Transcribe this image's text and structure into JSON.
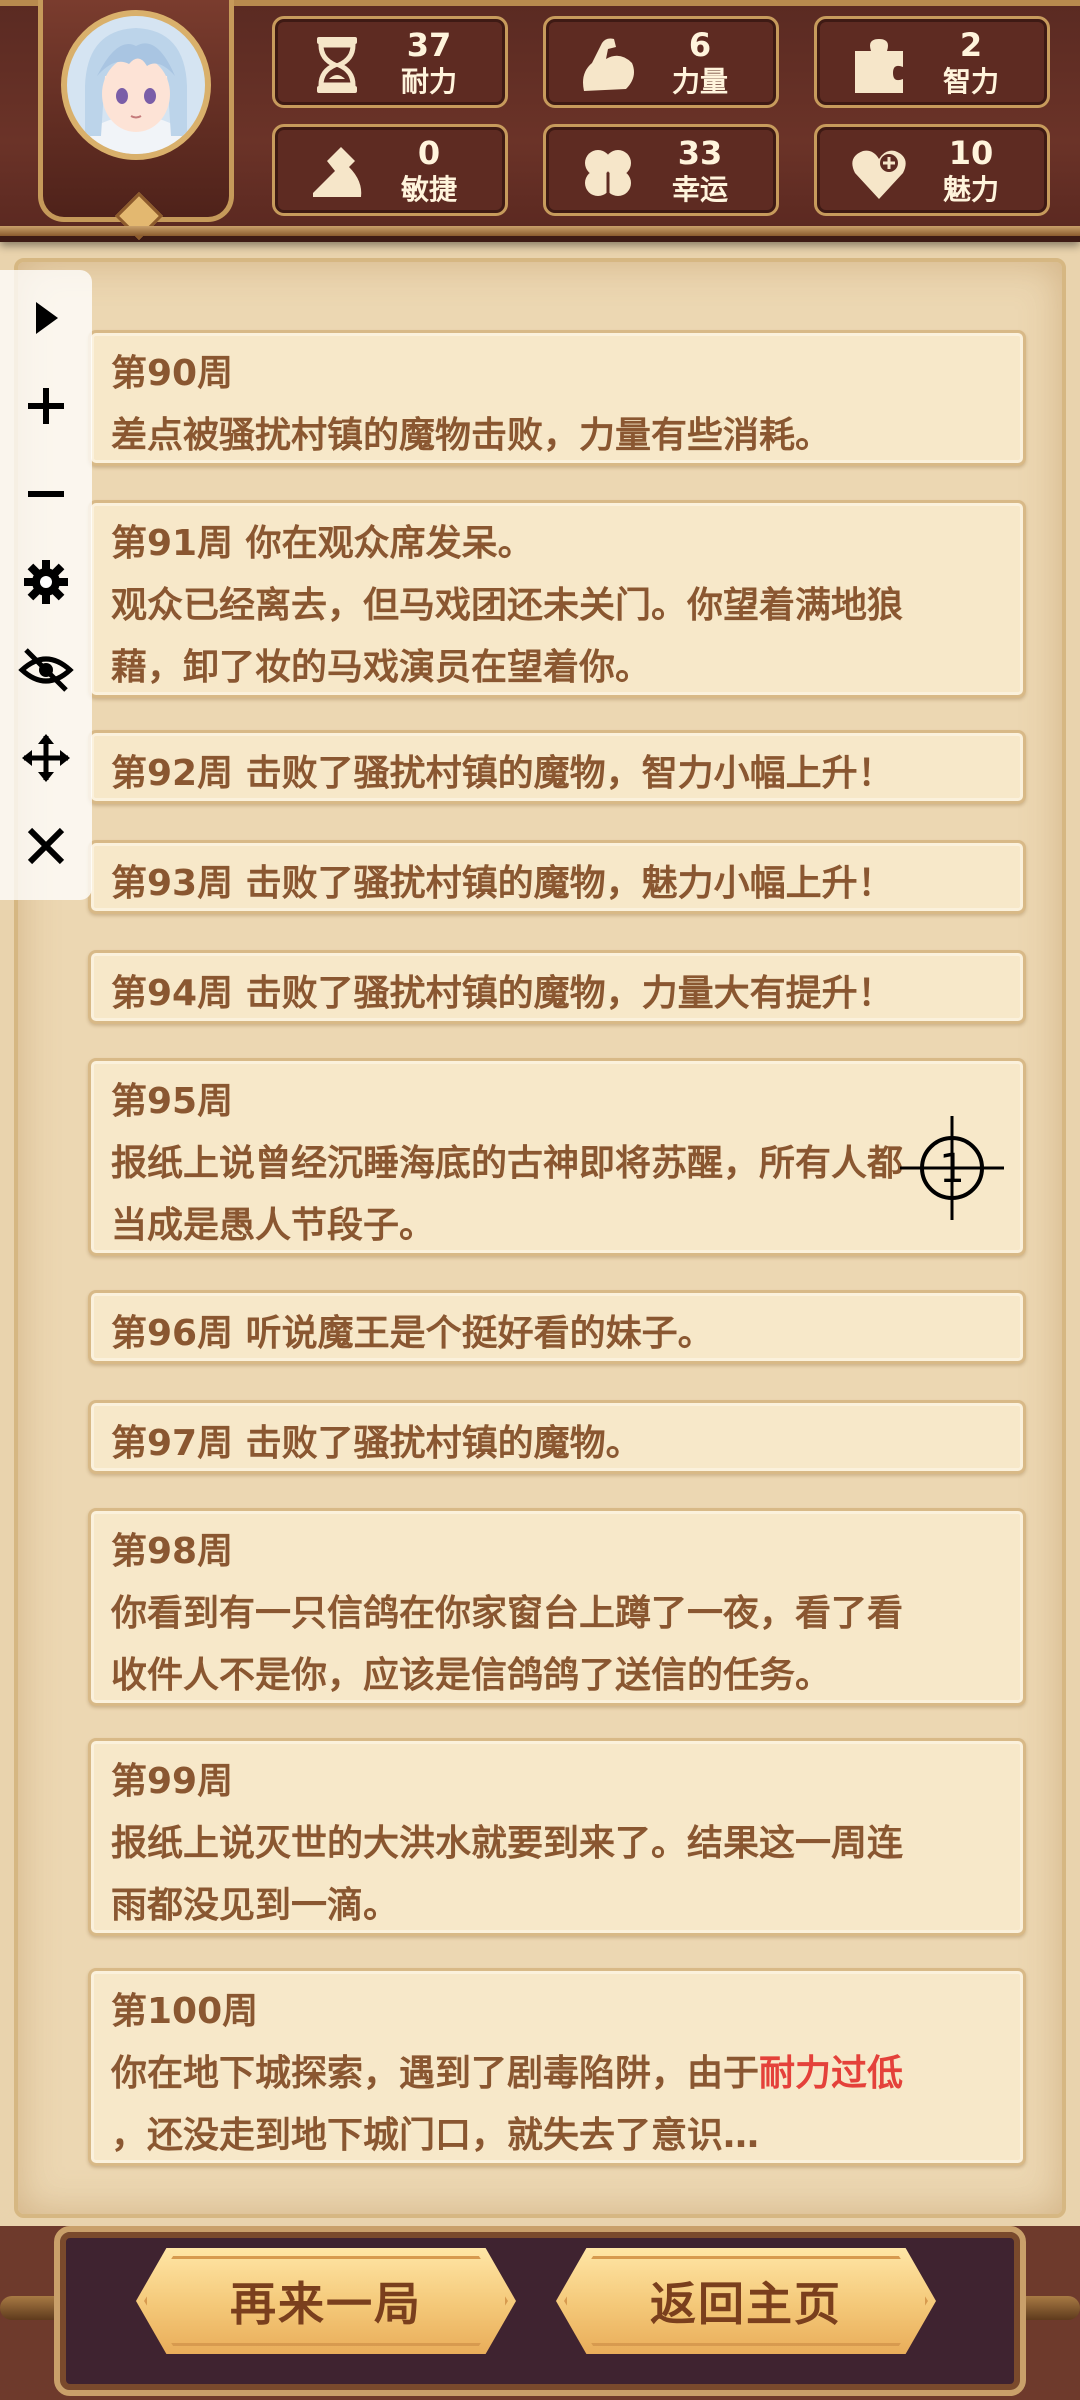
{
  "stats": [
    {
      "id": "stamina",
      "icon": "hourglass-icon",
      "value": "37",
      "label": "耐力"
    },
    {
      "id": "strength",
      "icon": "flexed-arm-icon",
      "value": "6",
      "label": "力量"
    },
    {
      "id": "intelligence",
      "icon": "puzzle-piece-icon",
      "value": "2",
      "label": "智力"
    },
    {
      "id": "agility",
      "icon": "boot-icon",
      "value": "0",
      "label": "敏捷"
    },
    {
      "id": "luck",
      "icon": "clover-icon",
      "value": "33",
      "label": "幸运"
    },
    {
      "id": "charm",
      "icon": "heart-plus-icon",
      "value": "10",
      "label": "魅力"
    }
  ],
  "log": [
    {
      "lines": [
        "第90周",
        "差点被骚扰村镇的魔物击败，力量有些消耗。"
      ]
    },
    {
      "lines": [
        "第91周 你在观众席发呆。",
        "观众已经离去，但马戏团还未关门。你望着满地狼",
        "藉，卸了妆的马戏演员在望着你。"
      ]
    },
    {
      "lines": [
        "第92周 击败了骚扰村镇的魔物，智力小幅上升！"
      ]
    },
    {
      "lines": [
        "第93周 击败了骚扰村镇的魔物，魅力小幅上升！"
      ]
    },
    {
      "lines": [
        "第94周 击败了骚扰村镇的魔物，力量大有提升！"
      ]
    },
    {
      "lines": [
        "第95周",
        "报纸上说曾经沉睡海底的古神即将苏醒，所有人都",
        "当成是愚人节段子。"
      ]
    },
    {
      "lines": [
        "第96周 听说魔王是个挺好看的妹子。"
      ]
    },
    {
      "lines": [
        "第97周 击败了骚扰村镇的魔物。"
      ]
    },
    {
      "lines": [
        "第98周",
        "你看到有一只信鸽在你家窗台上蹲了一夜，看了看",
        "收件人不是你，应该是信鸽鸽了送信的任务。"
      ]
    },
    {
      "lines": [
        "第99周",
        "报纸上说灭世的大洪水就要到来了。结果这一周连",
        "雨都没见到一滴。"
      ]
    },
    {
      "lines": [
        "第100周",
        "你在地下城探索，遇到了剧毒陷阱，由于",
        "，还没走到地下城门口，就失去了意识…"
      ],
      "highlight": "耐力过低"
    }
  ],
  "toolbar": {
    "icons": [
      "play-icon",
      "plus-icon",
      "minus-icon",
      "settings-gear-icon",
      "eye-hidden-icon",
      "move-icon",
      "close-icon"
    ]
  },
  "crosshair": {
    "label": "1"
  },
  "buttons": {
    "restart": "再来一局",
    "home": "返回主页"
  },
  "colors": {
    "text": "#8a5731",
    "highlight": "#e4413a",
    "header": "#5e2b22",
    "button": "#f4c878"
  }
}
